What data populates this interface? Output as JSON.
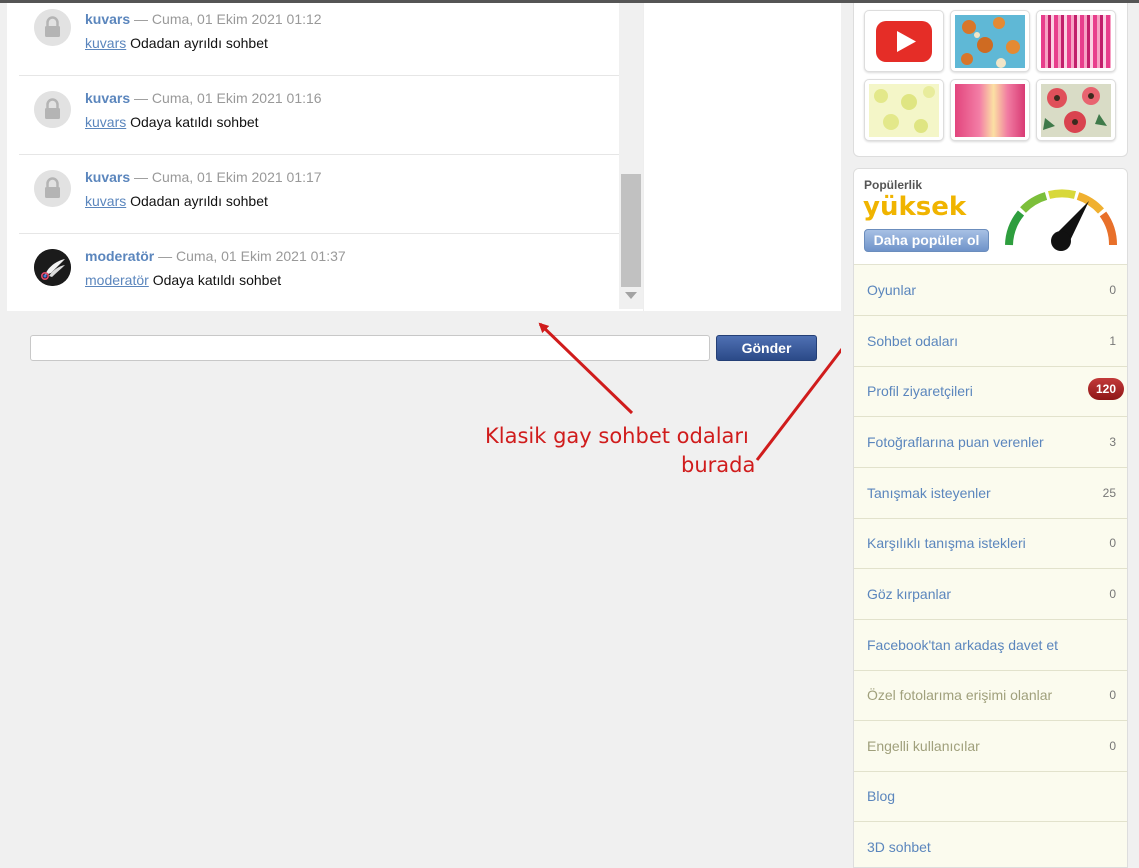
{
  "messages": [
    {
      "name": "kuvars",
      "meta": " — Cuma, 01 Ekim 2021 01:12",
      "link": "kuvars",
      "text": " Odadan ayrıldı sohbet"
    },
    {
      "name": "kuvars",
      "meta": " — Cuma, 01 Ekim 2021 01:16",
      "link": "kuvars",
      "text": " Odaya katıldı sohbet"
    },
    {
      "name": "kuvars",
      "meta": " — Cuma, 01 Ekim 2021 01:17",
      "link": "kuvars",
      "text": " Odadan ayrıldı sohbet"
    },
    {
      "name": "moderatör",
      "meta": " — Cuma, 01 Ekim 2021 01:37",
      "link": "moderatör",
      "text": " Odaya katıldı sohbet"
    }
  ],
  "composer": {
    "value": "",
    "send_label": "Gönder"
  },
  "annotation": {
    "line1": "Klasik gay sohbet  odaları",
    "line2": "burada",
    "color": "#d01c1c"
  },
  "gallery": {
    "items": [
      "youtube-icon",
      "pattern-monkeys",
      "pattern-pink-stripes",
      "pattern-yellow-flowers",
      "pattern-pink-gradient",
      "pattern-red-flowers"
    ]
  },
  "popularity": {
    "label": "Popülerlik",
    "level": "yüksek",
    "button": "Daha popüler ol"
  },
  "menu": [
    {
      "label": "Oyunlar",
      "count": "0"
    },
    {
      "label": "Sohbet odaları",
      "count": "1"
    },
    {
      "label": "Profil ziyaretçileri",
      "badge": "120"
    },
    {
      "label": "Fotoğraflarına puan verenler",
      "count": "3"
    },
    {
      "label": "Tanışmak isteyenler",
      "count": "25"
    },
    {
      "label": "Karşılıklı tanışma istekleri",
      "count": "0"
    },
    {
      "label": "Göz kırpanlar",
      "count": "0"
    },
    {
      "label": "Facebook'tan arkadaş davet et"
    },
    {
      "label": "Özel fotolarıma erişimi olanlar",
      "count": "0",
      "muted": true
    },
    {
      "label": "Engelli kullanıcılar",
      "count": "0",
      "muted": true
    },
    {
      "label": "Blog"
    },
    {
      "label": "3D sohbet"
    }
  ],
  "colors": {
    "link": "#5b86bd",
    "badge": "#a82424",
    "accent_yellow": "#f0b400"
  }
}
